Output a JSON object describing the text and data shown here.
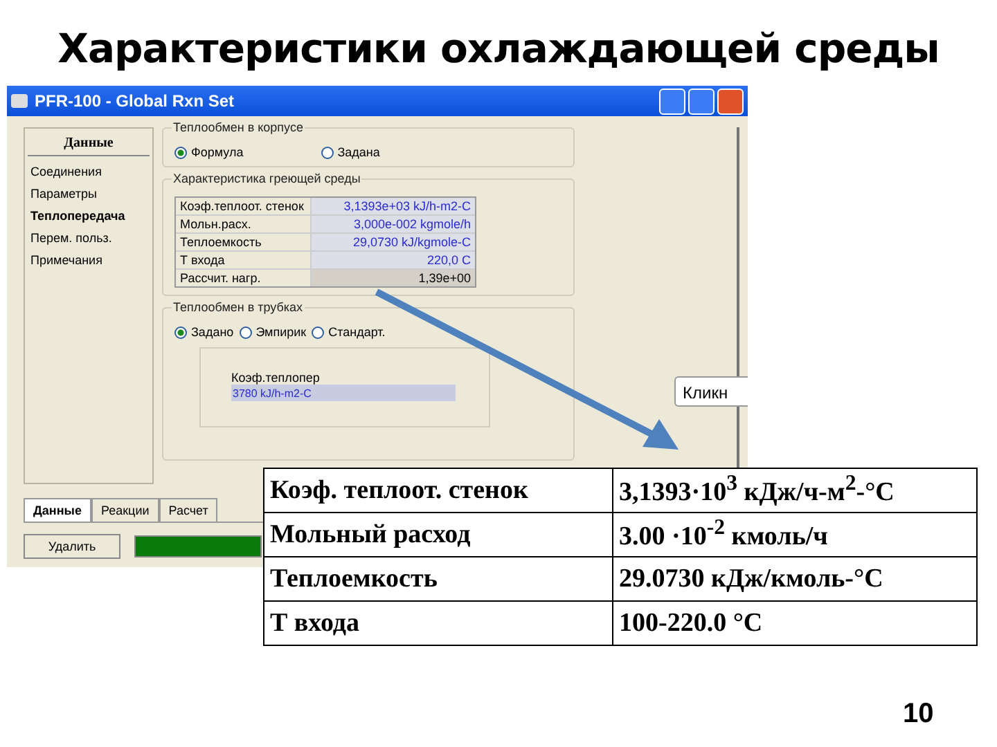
{
  "slide_title": "Характеристики охлаждающей среды",
  "window": {
    "title": "PFR-100 - Global Rxn Set",
    "sidebar": {
      "heading": "Данные",
      "items": [
        {
          "label": "Соединения",
          "selected": false
        },
        {
          "label": "Параметры",
          "selected": false
        },
        {
          "label": "Теплопередача",
          "selected": true
        },
        {
          "label": "Перем. польз.",
          "selected": false
        },
        {
          "label": "Примечания",
          "selected": false
        }
      ]
    },
    "shell_group": {
      "title": "Теплообмен в корпусе",
      "options": [
        {
          "label": "Формула",
          "selected": true
        },
        {
          "label": "Задана",
          "selected": false
        }
      ]
    },
    "medium_group": {
      "title": "Характеристика греющей среды",
      "rows": [
        {
          "label": "Коэф.теплоот. стенок",
          "value": "3,1393e+03 kJ/h-m2-C",
          "kind": "input"
        },
        {
          "label": "Мольн.расх.",
          "value": "3,000e-002 kgmole/h",
          "kind": "input"
        },
        {
          "label": "Теплоемкость",
          "value": "29,0730 kJ/kgmole-C",
          "kind": "input"
        },
        {
          "label": "Т входа",
          "value": "220,0 C",
          "kind": "input"
        },
        {
          "label": "Рассчит. нагр.",
          "value": "1,39e+00",
          "kind": "calc"
        }
      ]
    },
    "tube_group": {
      "title": "Теплообмен в трубках",
      "options": [
        {
          "label": "Задано",
          "selected": true
        },
        {
          "label": "Эмпирик",
          "selected": false
        },
        {
          "label": "Стандарт.",
          "selected": false
        }
      ],
      "field_label": "Коэф.теплопер",
      "field_value": "3780 kJ/h-m2-C"
    },
    "tooltip": "Кликн",
    "tabs": [
      {
        "label": "Данные",
        "selected": true
      },
      {
        "label": "Реакции",
        "selected": false
      },
      {
        "label": "Расчет",
        "selected": false
      }
    ],
    "delete_button": "Удалить",
    "progress": {
      "level": 1
    }
  },
  "table": {
    "rows": [
      {
        "label": "Коэф. теплоот. стенок",
        "value": "3,1393·10$^{3}$ кДж/ч-м$^{2}$-°С"
      },
      {
        "label": "Мольный расход",
        "value": "3.00 ·10$^{-2}$ кмоль/ч"
      },
      {
        "label": "Теплоемкость",
        "value": "29.0730 кДж/кмоль-°С"
      },
      {
        "label": "Т входа",
        "value": "100-220.0 °С"
      }
    ]
  },
  "page_number": "10"
}
